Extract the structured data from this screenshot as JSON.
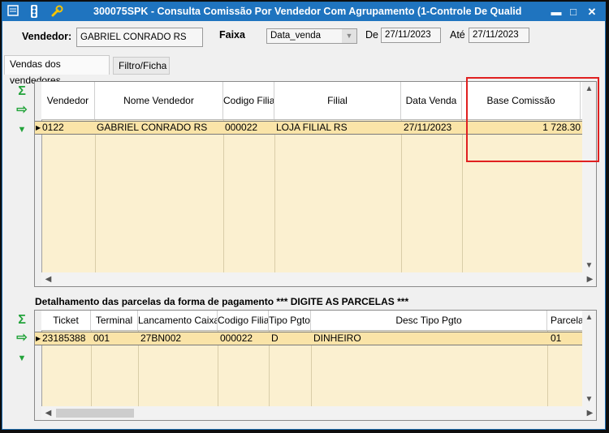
{
  "window": {
    "title": "300075SPK - Consulta Comissão Por Vendedor Com Agrupamento (1-Controle De Qualid",
    "icons": [
      "window-menu-icon",
      "traffic-light-icon",
      "wrench-icon"
    ],
    "controls": [
      "minimize",
      "restore",
      "close"
    ],
    "control_glyphs": {
      "minimize": "▬",
      "restore": "□",
      "close": "✕"
    }
  },
  "filters": {
    "vendedor_label": "Vendedor:",
    "vendedor_value": "GABRIEL CONRADO RS",
    "faixa_label": "Faixa",
    "faixa_value": "Data_venda",
    "de_label": "De",
    "de_value": "27/11/2023",
    "ate_label": "Até",
    "ate_value": "27/11/2023"
  },
  "tabs": [
    {
      "label": "Vendas dos vendedores",
      "active": true
    },
    {
      "label": "Filtro/Ficha",
      "active": false
    }
  ],
  "side_icons": {
    "sum": "Σ",
    "export": "⇨",
    "down": "▼"
  },
  "sales_grid": {
    "columns": [
      "Vendedor",
      "Nome Vendedor",
      "Codigo Filial",
      "Filial",
      "Data Venda",
      "Base Comissão"
    ],
    "rows": [
      [
        "0122",
        "GABRIEL CONRADO RS",
        "000022",
        "LOJA FILIAL RS",
        "27/11/2023",
        "1 728.30"
      ]
    ]
  },
  "section_title": "Detalhamento das parcelas da forma de pagamento *** DIGITE AS PARCELAS ***",
  "payments_grid": {
    "columns": [
      "Ticket",
      "Terminal",
      "Lancamento Caixa",
      "Codigo Filial",
      "Tipo Pgto",
      "Desc Tipo Pgto",
      "Parcela"
    ],
    "rows": [
      [
        "23185388",
        "001",
        "27BN002",
        "000022",
        "D",
        "DINHEIRO",
        "01"
      ]
    ]
  },
  "scroll_arrows": {
    "up": "▲",
    "down": "▼",
    "left": "◀",
    "right": "▶"
  },
  "colors": {
    "title_bar": "#1f74bf",
    "grid_bg": "#fbf0d0",
    "selected_row": "#fae4a8",
    "highlight_box": "#e02020",
    "icon_green": "#22a33a"
  }
}
